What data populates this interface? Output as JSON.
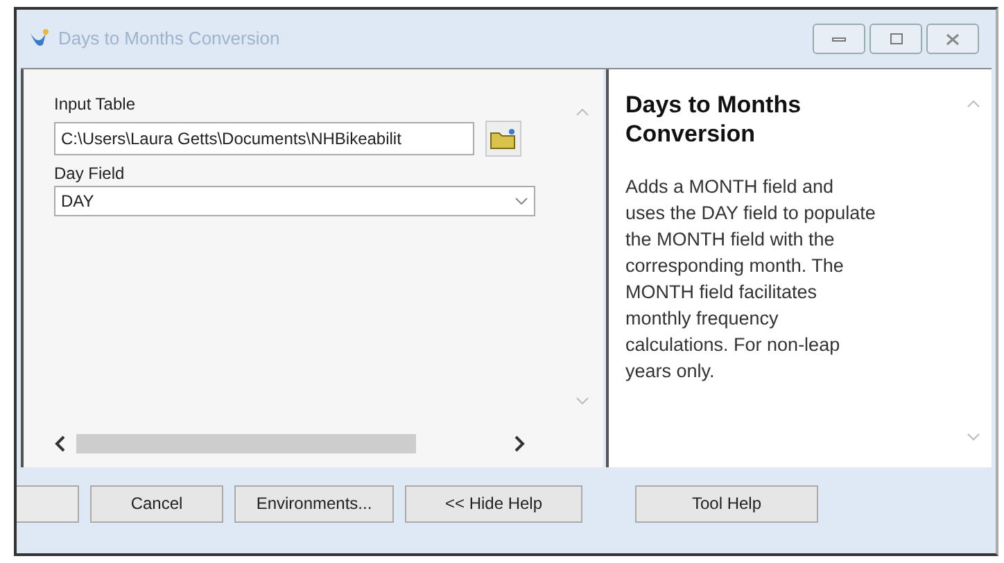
{
  "window": {
    "title": "Days to Months Conversion"
  },
  "form": {
    "input_table": {
      "label": "Input Table",
      "value": "C:\\Users\\Laura Getts\\Documents\\NHBikeabilit"
    },
    "day_field": {
      "label": "Day Field",
      "value": "DAY"
    }
  },
  "help": {
    "title": "Days to Months Conversion",
    "text": "Adds a MONTH field and uses the DAY field to populate the MONTH field with the corresponding month. The MONTH field facilitates monthly frequency calculations. For non-leap years only."
  },
  "buttons": [
    {
      "kind": "partial"
    },
    {
      "kind": "button",
      "label": "Cancel"
    },
    {
      "kind": "button",
      "label": "Environments..."
    },
    {
      "kind": "button",
      "label": "<< Hide Help"
    },
    {
      "kind": "button",
      "label": "Tool Help"
    }
  ]
}
